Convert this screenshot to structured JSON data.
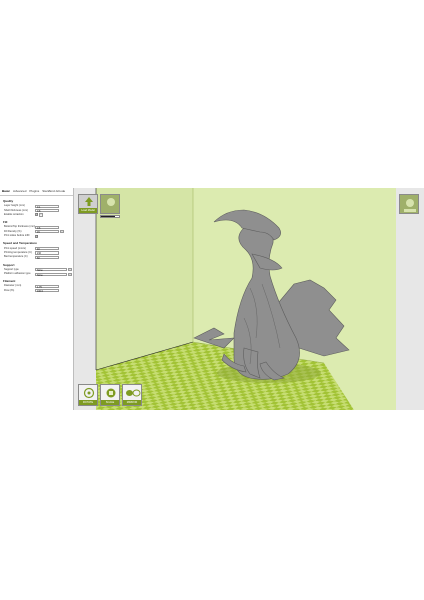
{
  "tabs": [
    "Basic",
    "Advanced",
    "Plugins",
    "Start/End-GCode"
  ],
  "sections": [
    {
      "title": "Quality",
      "fields": [
        {
          "label": "Layer height (mm)",
          "value": "0.1",
          "kind": "text"
        },
        {
          "label": "Shell thickness (mm)",
          "value": "0.8",
          "kind": "text"
        },
        {
          "label": "Enable retraction",
          "value": "✓",
          "kind": "check",
          "extra": "..."
        }
      ]
    },
    {
      "title": "Fill",
      "fields": [
        {
          "label": "Bottom/Top thickness (mm)",
          "value": "0.6",
          "kind": "text"
        },
        {
          "label": "Fill Density (%)",
          "value": "15",
          "kind": "text",
          "extra": "..."
        },
        {
          "label": "Print sides before infill",
          "value": "✓",
          "kind": "check"
        }
      ]
    },
    {
      "title": "Speed and Temperature",
      "fields": [
        {
          "label": "Print speed (mm/s)",
          "value": "40",
          "kind": "text"
        },
        {
          "label": "Printing temperature (C)",
          "value": "210",
          "kind": "text"
        },
        {
          "label": "Bed temperature (C)",
          "value": "60",
          "kind": "text"
        }
      ]
    },
    {
      "title": "Support",
      "fields": [
        {
          "label": "Support type",
          "value": "None",
          "kind": "select",
          "extra": "..."
        },
        {
          "label": "Platform adhesion type",
          "value": "None",
          "kind": "select",
          "extra": "..."
        }
      ]
    },
    {
      "title": "Filament",
      "fields": [
        {
          "label": "Diameter (mm)",
          "value": "1.75",
          "kind": "text"
        },
        {
          "label": "Flow (%)",
          "value": "100.0",
          "kind": "text"
        }
      ]
    }
  ],
  "buttons": {
    "load": "Load Model",
    "rotate": "ROTATE",
    "scale": "SCALE",
    "mirror": "MIRROR"
  },
  "colors": {
    "accent": "#7e9b22",
    "wall": "#d3e3a4",
    "floor_light": "#c4dc6e",
    "floor_dark": "#9cbf2e",
    "model": "#8e8e8e"
  }
}
